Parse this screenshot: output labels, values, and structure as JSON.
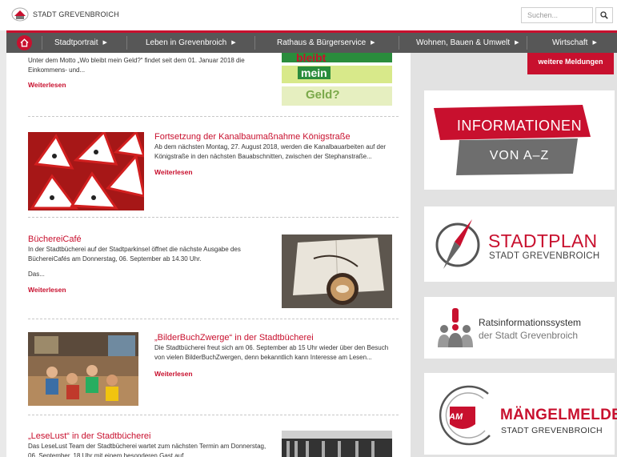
{
  "site": {
    "logo_text": "STADT GREVENBROICH"
  },
  "search": {
    "placeholder": "Suchen..."
  },
  "nav": {
    "items": [
      {
        "label": "Stadtportrait"
      },
      {
        "label": "Leben in Grevenbroich"
      },
      {
        "label": "Rathaus & Bürgerservice"
      },
      {
        "label": "Wohnen, Bauen & Umwelt"
      },
      {
        "label": "Wirtschaft"
      }
    ]
  },
  "articles": [
    {
      "title": "",
      "text": "Unter dem Motto „Wo bleibt mein Geld?“ findet seit dem 01. Januar 2018 die Einkommens- und...",
      "more": "Weiterlesen",
      "image_words": [
        "bleibt",
        "mein",
        "Geld?"
      ]
    },
    {
      "title": "Fortsetzung der Kanalbaumaßnahme Königstraße",
      "text": "Ab dem nächsten Montag, 27. August 2018, werden die Kanalbauarbeiten auf der Königstraße in den nächsten Bauabschnitten, zwischen der Stephanstraße...",
      "more": "Weiterlesen"
    },
    {
      "title": "BüchereiCafé",
      "text": "In der Stadtbücherei auf der Stadtparkinsel öffnet die nächste Ausgabe des BüchereiCafés am Donnerstag, 06. September ab 14.30 Uhr.",
      "text2": "Das...",
      "more": "Weiterlesen"
    },
    {
      "title": "„BilderBuchZwerge“ in der Stadtbücherei",
      "text": "Die Stadtbücherei freut sich am 06. September ab 15 Uhr wieder über den Besuch von vielen BilderBuchZwergen, denn bekanntlich kann Interesse am Lesen...",
      "more": "Weiterlesen"
    },
    {
      "title": "„LeseLust“ in der Stadtbücherei",
      "text": "Das LeseLust Team der Stadtbücherei wartet zum nächsten Termin am Donnerstag, 06. September, 18 Uhr mit einem besonderen Gast auf"
    }
  ],
  "sidebar": {
    "more_news": "weitere Meldungen",
    "info": {
      "line1": "INFORMATIONEN",
      "line2": "VON A–Z"
    },
    "stadtplan": {
      "line1": "STADTPLAN",
      "line2": "STADT GREVENBROICH"
    },
    "ratsinfo": {
      "line1": "Ratsinformationssystem",
      "line2": "der Stadt Grevenbroich"
    },
    "maengel": {
      "line1": "MÄNGELMELDER",
      "line2": "STADT GREVENBROICH",
      "badge": "AM"
    }
  },
  "colors": {
    "brand_red": "#c8102e",
    "nav_gray": "#575757",
    "info_gray": "#6e6e6e"
  }
}
